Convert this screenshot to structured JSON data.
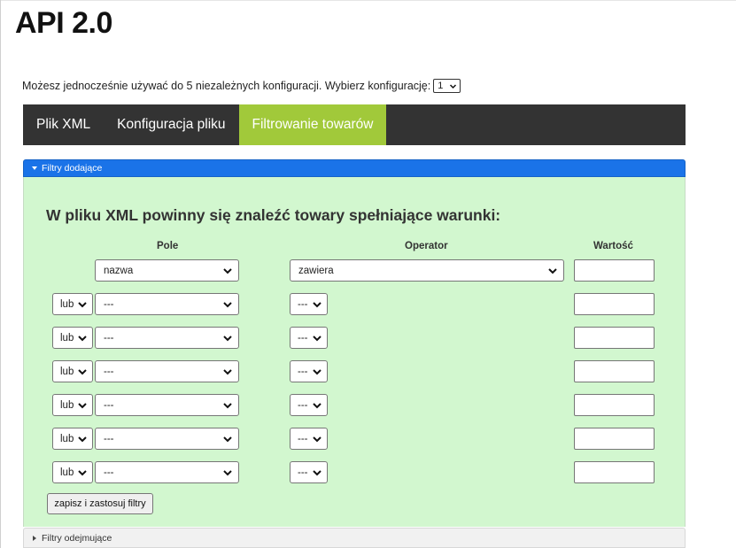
{
  "page": {
    "title": "API 2.0"
  },
  "config": {
    "text": "Możesz jednocześnie używać do 5 niezależnych konfiguracji. Wybierz konfigurację:",
    "selected": "1"
  },
  "nav": {
    "tabs": [
      {
        "label": "Plik XML",
        "active": false
      },
      {
        "label": "Konfiguracja pliku",
        "active": false
      },
      {
        "label": "Filtrowanie towarów",
        "active": true
      }
    ],
    "colors": {
      "bar": "#333333",
      "active": "#a1c93a"
    }
  },
  "add_filters": {
    "header": "Filtry dodające",
    "heading": "W pliku XML powinny się znaleźć towary spełniające warunki:",
    "columns": {
      "field": "Pole",
      "operator": "Operator",
      "value": "Wartość"
    },
    "rows": [
      {
        "logic": "",
        "field": "nazwa",
        "operator": "zawiera",
        "value": ""
      },
      {
        "logic": "lub",
        "field": "---",
        "operator": "---",
        "value": ""
      },
      {
        "logic": "lub",
        "field": "---",
        "operator": "---",
        "value": ""
      },
      {
        "logic": "lub",
        "field": "---",
        "operator": "---",
        "value": ""
      },
      {
        "logic": "lub",
        "field": "---",
        "operator": "---",
        "value": ""
      },
      {
        "logic": "lub",
        "field": "---",
        "operator": "---",
        "value": ""
      },
      {
        "logic": "lub",
        "field": "---",
        "operator": "---",
        "value": ""
      }
    ],
    "save_label": "zapisz i zastosuj filtry",
    "colors": {
      "header": "#1a73e8",
      "body": "#d2f7cf"
    }
  },
  "subtract_filters": {
    "header": "Filtry odejmujące"
  }
}
